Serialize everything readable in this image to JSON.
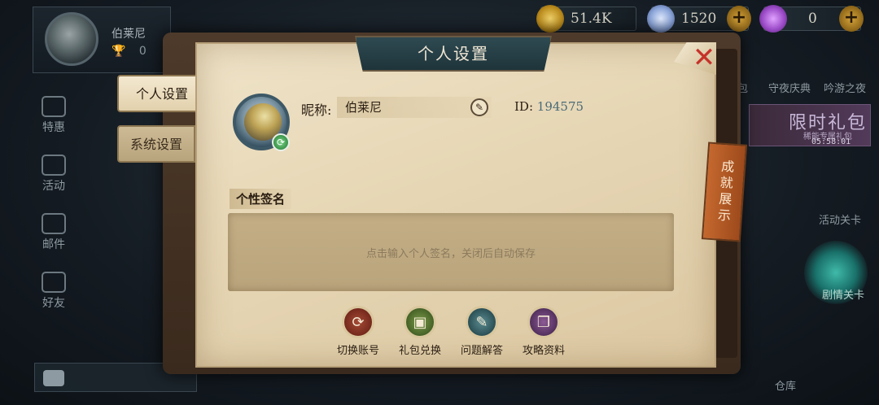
{
  "player": {
    "name": "伯莱尼",
    "trophies": "0"
  },
  "left_nav": [
    {
      "label": "特惠"
    },
    {
      "label": "活动"
    },
    {
      "label": "邮件"
    },
    {
      "label": "好友"
    }
  ],
  "currency": {
    "coins": "51.4K",
    "diamonds": "1520",
    "tickets": "0"
  },
  "right_menu": {
    "item_1": "包",
    "item_2": "守夜庆典",
    "item_3": "吟游之夜",
    "limited_title": "限时礼包",
    "limited_sub": "稀能专属礼包",
    "limited_time": "05:58:01",
    "activity_stage": "活动关卡",
    "story_stage": "剧情关卡",
    "warehouse": "仓库"
  },
  "dialog": {
    "title": "个人设置",
    "close": "✕",
    "tabs": [
      {
        "label": "个人设置",
        "active": true
      },
      {
        "label": "系统设置",
        "active": false
      }
    ],
    "nickname_label": "昵称:",
    "nickname_value": "伯莱尼",
    "id_label": "ID:",
    "id_value": "194575",
    "signature_label": "个性签名",
    "signature_placeholder": "点击输入个人签名，关闭后自动保存",
    "achievement_tab": "成就展示",
    "actions": [
      {
        "label": "切换账号",
        "icon": "switch-account-icon",
        "glyph": "⟳"
      },
      {
        "label": "礼包兑换",
        "icon": "gift-icon",
        "glyph": "▣"
      },
      {
        "label": "问题解答",
        "icon": "question-icon",
        "glyph": "✎"
      },
      {
        "label": "攻略资料",
        "icon": "guide-book-icon",
        "glyph": "❐"
      }
    ]
  }
}
